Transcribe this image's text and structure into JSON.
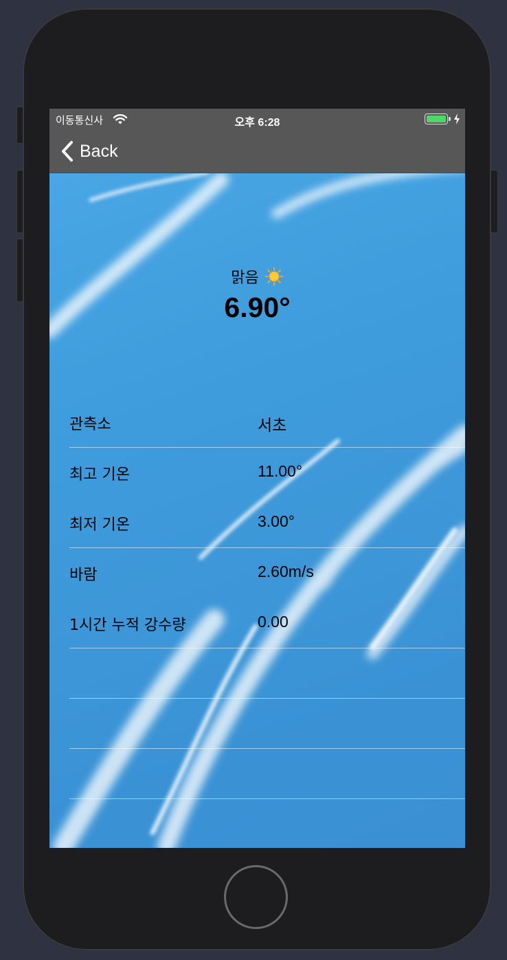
{
  "status_bar": {
    "carrier": "이동통신사",
    "time": "오후 6:28",
    "battery_level": 1.0
  },
  "nav": {
    "back_label": "Back"
  },
  "weather": {
    "condition": "맑음",
    "temperature": "6.90°"
  },
  "details": [
    {
      "label": "관측소",
      "value": "서초"
    },
    {
      "label": "최고 기온",
      "value": "11.00°"
    },
    {
      "label": "최저 기온",
      "value": "3.00°"
    },
    {
      "label": "바람",
      "value": "2.60m/s"
    },
    {
      "label": "1시간 누적 강수량",
      "value": "0.00"
    }
  ],
  "colors": {
    "bar_background": "#575757",
    "sky": "#3c9bdd",
    "battery": "#4cd964"
  },
  "icons": [
    "wifi-icon",
    "battery-icon",
    "charging-bolt-icon",
    "chevron-left-icon",
    "sun-icon"
  ]
}
